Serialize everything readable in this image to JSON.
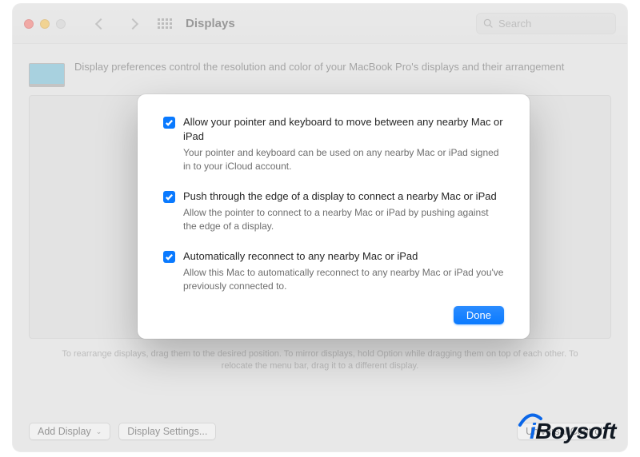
{
  "toolbar": {
    "title": "Displays",
    "search_placeholder": "Search"
  },
  "description": "Display preferences control the resolution and color of your MacBook Pro's displays and their arrangement",
  "footer_hint": "To rearrange displays, drag them to the desired position. To mirror displays, hold Option while dragging them on top of each other. To relocate the menu bar, drag it to a different display.",
  "buttons": {
    "add_display": "Add Display",
    "display_settings": "Display Settings...",
    "universal_control": "Universal Control"
  },
  "modal": {
    "options": [
      {
        "title": "Allow your pointer and keyboard to move between any nearby Mac or iPad",
        "sub": "Your pointer and keyboard can be used on any nearby Mac or iPad signed in to your iCloud account."
      },
      {
        "title": "Push through the edge of a display to connect a nearby Mac or iPad",
        "sub": "Allow the pointer to connect to a nearby Mac or iPad by pushing against the edge of a display."
      },
      {
        "title": "Automatically reconnect to any nearby Mac or iPad",
        "sub": "Allow this Mac to automatically reconnect to any nearby Mac or iPad you've previously connected to."
      }
    ],
    "done": "Done"
  },
  "watermark": {
    "i": "i",
    "b": "Boysoft"
  }
}
